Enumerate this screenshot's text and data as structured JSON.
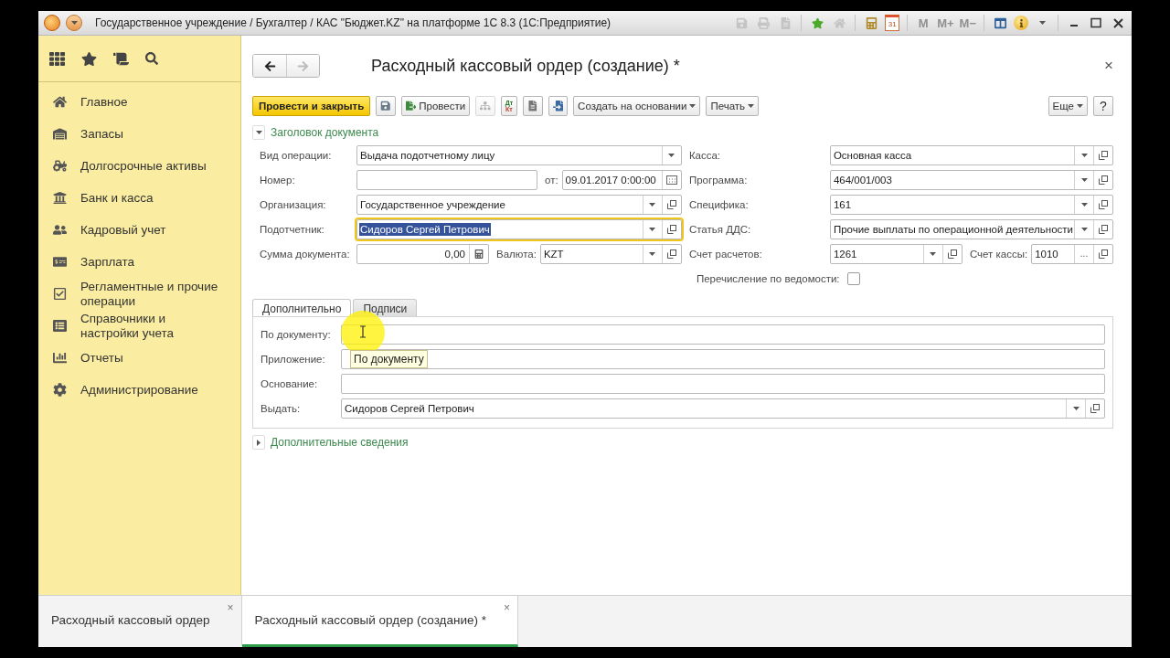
{
  "window": {
    "title": "Государственное учреждение / Бухгалтер / КАС \"Бюджет.KZ\" на платформе 1С 8.3  (1С:Предприятие)",
    "tools": [
      {
        "kind": "save",
        "disabled": true
      },
      {
        "kind": "print",
        "disabled": true
      },
      {
        "kind": "preview",
        "disabled": true
      },
      {
        "kind": "favorite",
        "disabled": false
      },
      {
        "kind": "home",
        "disabled": true
      },
      {
        "kind": "calculator",
        "disabled": false
      },
      {
        "kind": "calendar",
        "label": "31",
        "disabled": false
      },
      {
        "kind": "memory",
        "label": "M",
        "disabled": true
      },
      {
        "kind": "memory",
        "label": "M+",
        "disabled": true
      },
      {
        "kind": "memory",
        "label": "M−",
        "disabled": true
      },
      {
        "kind": "panels",
        "disabled": false
      },
      {
        "kind": "info",
        "disabled": false
      }
    ]
  },
  "sidebar": {
    "items": [
      {
        "label": "Главное"
      },
      {
        "label": "Запасы"
      },
      {
        "label": "Долгосрочные активы"
      },
      {
        "label": "Банк и касса"
      },
      {
        "label": "Кадровый учет"
      },
      {
        "label": "Зарплата"
      },
      {
        "label": "Регламентные и прочие операции"
      },
      {
        "label": "Справочники и настройки учета"
      },
      {
        "label": "Отчеты"
      },
      {
        "label": "Администрирование"
      }
    ]
  },
  "form": {
    "nav": [
      {
        "kind": "back",
        "disabled": false
      },
      {
        "kind": "forward",
        "disabled": true
      }
    ],
    "title": "Расходный кассовый ордер (создание) *",
    "close": "×",
    "toolbar": [
      {
        "kind": "primary",
        "label": "Провести и закрыть",
        "disabled": false
      },
      {
        "kind": "save",
        "disabled": false
      },
      {
        "kind": "post",
        "label": "Провести",
        "disabled": false
      },
      {
        "kind": "structure",
        "disabled": true
      },
      {
        "kind": "dtkt",
        "label": "Дт",
        "sublabel": "Кт",
        "disabled": false
      },
      {
        "kind": "report",
        "disabled": false
      },
      {
        "kind": "attach",
        "disabled": false
      },
      {
        "kind": "menu",
        "label": "Создать на основании",
        "disabled": false
      },
      {
        "kind": "menu",
        "label": "Печать",
        "disabled": false
      }
    ],
    "toolbar_right": [
      {
        "kind": "menu",
        "label": "Еще"
      },
      {
        "kind": "help",
        "label": "?"
      }
    ],
    "groups": [
      {
        "title": "Заголовок документа",
        "expanded": true
      },
      {
        "title": "Дополнительные сведения",
        "expanded": false
      }
    ],
    "left_rows": [
      {
        "kind": "fields",
        "items": [
          {
            "label": "Вид операции:",
            "value": "Выдача подотчетному лицу",
            "buttons": [
              {
                "kind": "dropdown"
              }
            ],
            "focused": false
          }
        ]
      },
      {
        "kind": "fields",
        "items": [
          {
            "label": "Номер:",
            "focused": false
          },
          {
            "label": "от:",
            "value": "09.01.2017  0:00:00",
            "buttons": [
              {
                "kind": "calendar"
              }
            ],
            "focused": false
          }
        ]
      },
      {
        "kind": "fields",
        "items": [
          {
            "label": "Организация:",
            "value": "Государственное учреждение",
            "buttons": [
              {
                "kind": "dropdown"
              },
              {
                "kind": "open"
              }
            ],
            "focused": false
          }
        ]
      },
      {
        "kind": "fields",
        "items": [
          {
            "label": "Подотчетник:",
            "value": "Сидоров Сергей Петрович",
            "buttons": [
              {
                "kind": "dropdown"
              },
              {
                "kind": "open"
              }
            ],
            "focused": true,
            "text_selected": true
          }
        ]
      },
      {
        "kind": "fields",
        "items": [
          {
            "label": "Сумма документа:",
            "value": "0,00",
            "kind": "amount",
            "buttons": [
              {
                "kind": "calculator"
              }
            ],
            "focused": false
          },
          {
            "label": "Валюта:",
            "value": "KZT",
            "buttons": [
              {
                "kind": "dropdown"
              },
              {
                "kind": "open"
              }
            ],
            "focused": false
          }
        ]
      }
    ],
    "right_rows": [
      {
        "kind": "fields",
        "items": [
          {
            "label": "Касса:",
            "value": "Основная касса",
            "buttons": [
              {
                "kind": "dropdown"
              },
              {
                "kind": "open"
              }
            ],
            "focused": false
          }
        ]
      },
      {
        "kind": "fields",
        "items": [
          {
            "label": "Программа:",
            "value": "464/001/003",
            "buttons": [
              {
                "kind": "dropdown"
              },
              {
                "kind": "open"
              }
            ],
            "focused": false
          }
        ]
      },
      {
        "kind": "fields",
        "items": [
          {
            "label": "Специфика:",
            "value": "161",
            "buttons": [
              {
                "kind": "dropdown"
              },
              {
                "kind": "open"
              }
            ],
            "focused": false
          }
        ]
      },
      {
        "kind": "fields",
        "items": [
          {
            "label": "Статья ДДС:",
            "value": "Прочие выплаты по операционной деятельности",
            "buttons": [
              {
                "kind": "dropdown"
              },
              {
                "kind": "open"
              }
            ],
            "focused": false
          }
        ]
      },
      {
        "kind": "fields",
        "items": [
          {
            "label": "Счет расчетов:",
            "value": "1261",
            "buttons": [
              {
                "kind": "dropdown"
              },
              {
                "kind": "open"
              }
            ],
            "focused": false
          },
          {
            "label": "Счет кассы:",
            "value": "1010",
            "buttons": [
              {
                "kind": "choose",
                "label": "..."
              },
              {
                "kind": "open"
              }
            ],
            "focused": false
          }
        ]
      },
      {
        "kind": "checkbox",
        "label": "Перечисление по ведомости:",
        "checked": false
      }
    ],
    "tabs": [
      {
        "label": "Дополнительно",
        "selected": true
      },
      {
        "label": "Подписи",
        "selected": false
      }
    ],
    "tab_rows": [
      {
        "kind": "fields",
        "items": [
          {
            "label": "По документу:",
            "focused": false
          }
        ]
      },
      {
        "kind": "fields",
        "items": [
          {
            "label": "Приложение:",
            "focused": false
          }
        ]
      },
      {
        "kind": "fields",
        "items": [
          {
            "label": "Основание:",
            "focused": false
          }
        ]
      },
      {
        "kind": "fields",
        "items": [
          {
            "label": "Выдать:",
            "value": "Сидоров Сергей Петрович",
            "buttons": [
              {
                "kind": "dropdown"
              },
              {
                "kind": "open"
              }
            ],
            "focused": false
          }
        ]
      }
    ],
    "tooltip": "По документу"
  },
  "open_windows": [
    {
      "label": "Расходный кассовый ордер",
      "selected": false,
      "close": "×"
    },
    {
      "label": "Расходный кассовый ордер (создание) *",
      "selected": true,
      "close": "×"
    }
  ]
}
